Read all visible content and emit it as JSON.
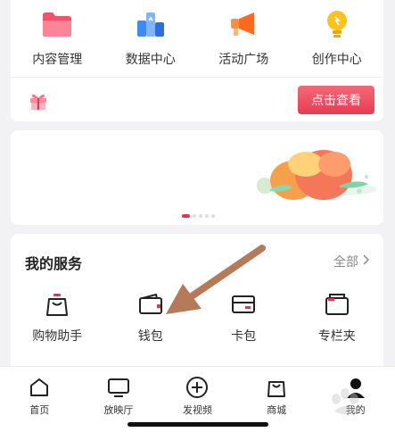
{
  "tools": [
    {
      "label": "内容管理",
      "icon": "folder-icon"
    },
    {
      "label": "数据中心",
      "icon": "data-chart-icon"
    },
    {
      "label": "活动广场",
      "icon": "megaphone-icon"
    },
    {
      "label": "创作中心",
      "icon": "lightbulb-icon"
    }
  ],
  "promo": {
    "icon": "gift-icon",
    "button_label": "点击查看"
  },
  "banner": {
    "page_count": 5,
    "active_index": 0
  },
  "services": {
    "title": "我的服务",
    "all_label": "全部",
    "items": [
      {
        "label": "购物助手",
        "icon": "shopping-bag-icon"
      },
      {
        "label": "钱包",
        "icon": "wallet-icon"
      },
      {
        "label": "卡包",
        "icon": "card-holder-icon"
      },
      {
        "label": "专栏夹",
        "icon": "column-folder-icon"
      }
    ]
  },
  "nav": [
    {
      "label": "首页",
      "icon": "home-icon"
    },
    {
      "label": "放映厅",
      "icon": "tv-icon"
    },
    {
      "label": "发视频",
      "icon": "add-video-icon"
    },
    {
      "label": "商城",
      "icon": "mall-bag-icon"
    },
    {
      "label": "我的",
      "icon": "profile-icon"
    }
  ],
  "colors": {
    "accent": "#e8344e",
    "background": "#f2f2f4"
  }
}
